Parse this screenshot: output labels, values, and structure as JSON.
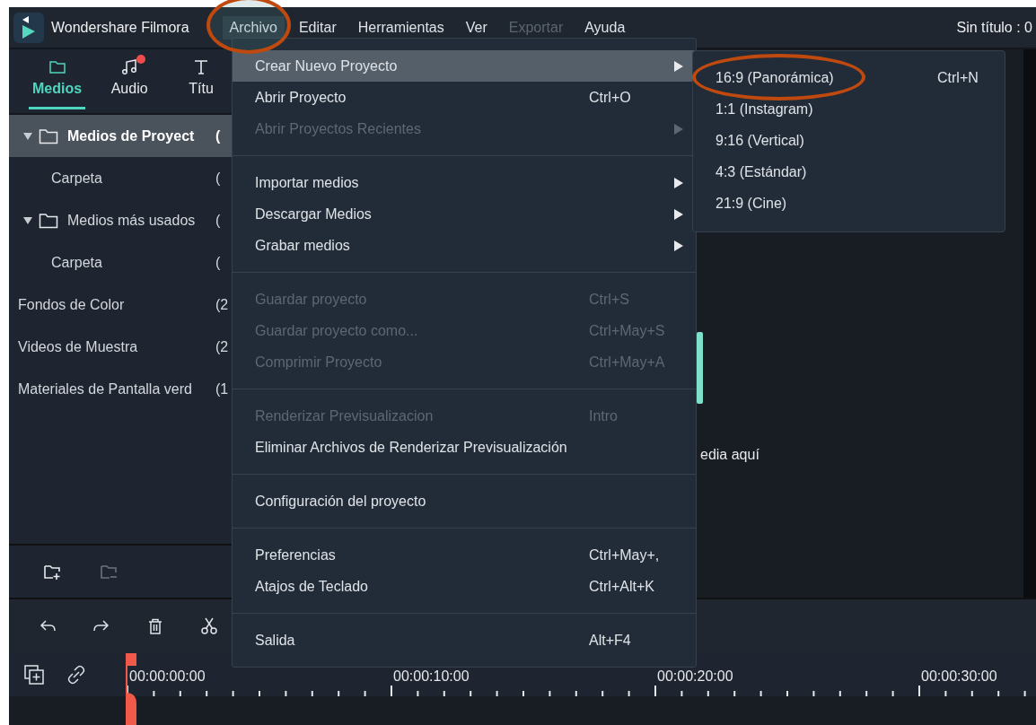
{
  "app": {
    "name": "Wondershare Filmora",
    "title": "Sin título : 0"
  },
  "menubar": [
    {
      "label": "Archivo",
      "selected": true,
      "disabled": false,
      "highlighted": true
    },
    {
      "label": "Editar",
      "selected": false,
      "disabled": false,
      "highlighted": false
    },
    {
      "label": "Herramientas",
      "selected": false,
      "disabled": false,
      "highlighted": false
    },
    {
      "label": "Ver",
      "selected": false,
      "disabled": false,
      "highlighted": false
    },
    {
      "label": "Exportar",
      "selected": false,
      "disabled": true,
      "highlighted": false
    },
    {
      "label": "Ayuda",
      "selected": false,
      "disabled": false,
      "highlighted": false
    }
  ],
  "tabs": [
    {
      "kind": "folder",
      "label": "Medios",
      "selected": true,
      "badge": false
    },
    {
      "kind": "music",
      "label": "Audio",
      "selected": false,
      "badge": true
    },
    {
      "kind": "text",
      "label": "Títu",
      "selected": false,
      "badge": false
    }
  ],
  "tree": [
    {
      "kind": "folder",
      "label": "Medios de Proyect",
      "count": "(",
      "expanded": true,
      "selected": true,
      "children": [
        {
          "kind": "plain",
          "label": "Carpeta",
          "count": "(",
          "selected": false
        }
      ]
    },
    {
      "kind": "folder",
      "label": "Medios más usados",
      "count": "(",
      "expanded": true,
      "selected": false,
      "children": [
        {
          "kind": "plain",
          "label": "Carpeta",
          "count": "(",
          "selected": false
        }
      ]
    },
    {
      "kind": "plain",
      "label": "Fondos de Color",
      "count": "(2",
      "selected": false
    },
    {
      "kind": "plain",
      "label": "Videos de Muestra",
      "count": "(2",
      "selected": false
    },
    {
      "kind": "plain",
      "label": "Materiales de Pantalla verd",
      "count": "(1",
      "selected": false
    }
  ],
  "panel_actions": [
    {
      "kind": "new-folder",
      "disabled": false
    },
    {
      "kind": "delete-folder",
      "disabled": true
    }
  ],
  "preview": {
    "hint": "edia aquí"
  },
  "timeline": {
    "timecodes": [
      "00:00:00:00",
      "00:00:10:00",
      "00:00:20:00",
      "00:00:30:00"
    ]
  },
  "menu": [
    {
      "kind": "item",
      "label": "Crear Nuevo Proyecto",
      "submenu": true,
      "disabled": false,
      "selected": true
    },
    {
      "kind": "item",
      "label": "Abrir Proyecto",
      "shortcut": "Ctrl+O",
      "submenu": false,
      "disabled": false,
      "selected": false
    },
    {
      "kind": "item",
      "label": "Abrir Proyectos Recientes",
      "submenu": true,
      "disabled": true,
      "selected": false
    },
    {
      "kind": "separator"
    },
    {
      "kind": "item",
      "label": "Importar medios",
      "submenu": true,
      "disabled": false,
      "selected": false
    },
    {
      "kind": "item",
      "label": "Descargar Medios",
      "submenu": true,
      "disabled": false,
      "selected": false
    },
    {
      "kind": "item",
      "label": "Grabar medios",
      "submenu": true,
      "disabled": false,
      "selected": false
    },
    {
      "kind": "separator"
    },
    {
      "kind": "item",
      "label": "Guardar proyecto",
      "shortcut": "Ctrl+S",
      "submenu": false,
      "disabled": true,
      "selected": false
    },
    {
      "kind": "item",
      "label": "Guardar proyecto como...",
      "shortcut": "Ctrl+May+S",
      "submenu": false,
      "disabled": true,
      "selected": false
    },
    {
      "kind": "item",
      "label": "Comprimir Proyecto",
      "shortcut": "Ctrl+May+A",
      "submenu": false,
      "disabled": true,
      "selected": false
    },
    {
      "kind": "separator"
    },
    {
      "kind": "item",
      "label": "Renderizar Previsualizacion",
      "shortcut": "Intro",
      "submenu": false,
      "disabled": true,
      "selected": false
    },
    {
      "kind": "item",
      "label": "Eliminar Archivos de Renderizar Previsualización",
      "submenu": false,
      "disabled": false,
      "selected": false
    },
    {
      "kind": "separator"
    },
    {
      "kind": "item",
      "label": "Configuración del proyecto",
      "submenu": false,
      "disabled": false,
      "selected": false
    },
    {
      "kind": "separator"
    },
    {
      "kind": "item",
      "label": "Preferencias",
      "shortcut": "Ctrl+May+,",
      "submenu": false,
      "disabled": false,
      "selected": false
    },
    {
      "kind": "item",
      "label": "Atajos de Teclado",
      "shortcut": "Ctrl+Alt+K",
      "submenu": false,
      "disabled": false,
      "selected": false
    },
    {
      "kind": "separator"
    },
    {
      "kind": "item",
      "label": "Salida",
      "shortcut": "Alt+F4",
      "submenu": false,
      "disabled": false,
      "selected": false
    }
  ],
  "submenu": [
    {
      "label": "16:9 (Panorámica)",
      "shortcut": "Ctrl+N",
      "highlighted": true
    },
    {
      "label": "1:1 (Instagram)",
      "highlighted": false
    },
    {
      "label": "9:16 (Vertical)",
      "highlighted": false
    },
    {
      "label": "4:3 (Estándar)",
      "highlighted": false
    },
    {
      "label": "21:9 (Cine)",
      "highlighted": false
    }
  ]
}
